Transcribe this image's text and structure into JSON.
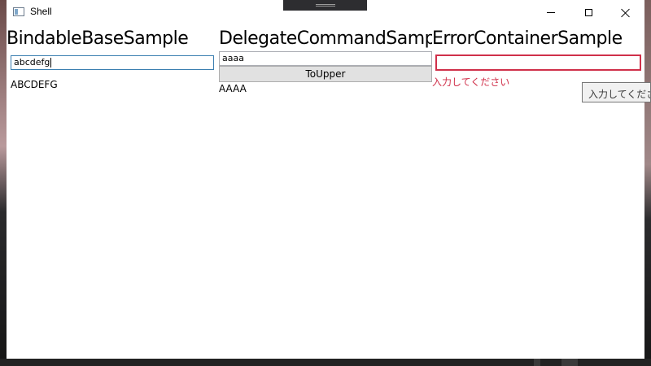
{
  "window": {
    "title": "Shell",
    "controls": [
      "minimize-icon",
      "maximize-icon",
      "close-icon"
    ]
  },
  "columns": [
    {
      "heading": "BindableBaseSample",
      "input_value": "abcdefg",
      "output": "ABCDEFG"
    },
    {
      "heading": "DelegateCommandSample",
      "input_value": "aaaa",
      "button_label": "ToUpper",
      "output": "AAAA"
    },
    {
      "heading": "ErrorContainerSample",
      "input_value": "",
      "error_message": "入力してください",
      "tooltip": "入力してください"
    }
  ],
  "colors": {
    "error": "#d0304a",
    "focus_border": "#3c7fb1",
    "button_bg": "#e1e1e1"
  }
}
